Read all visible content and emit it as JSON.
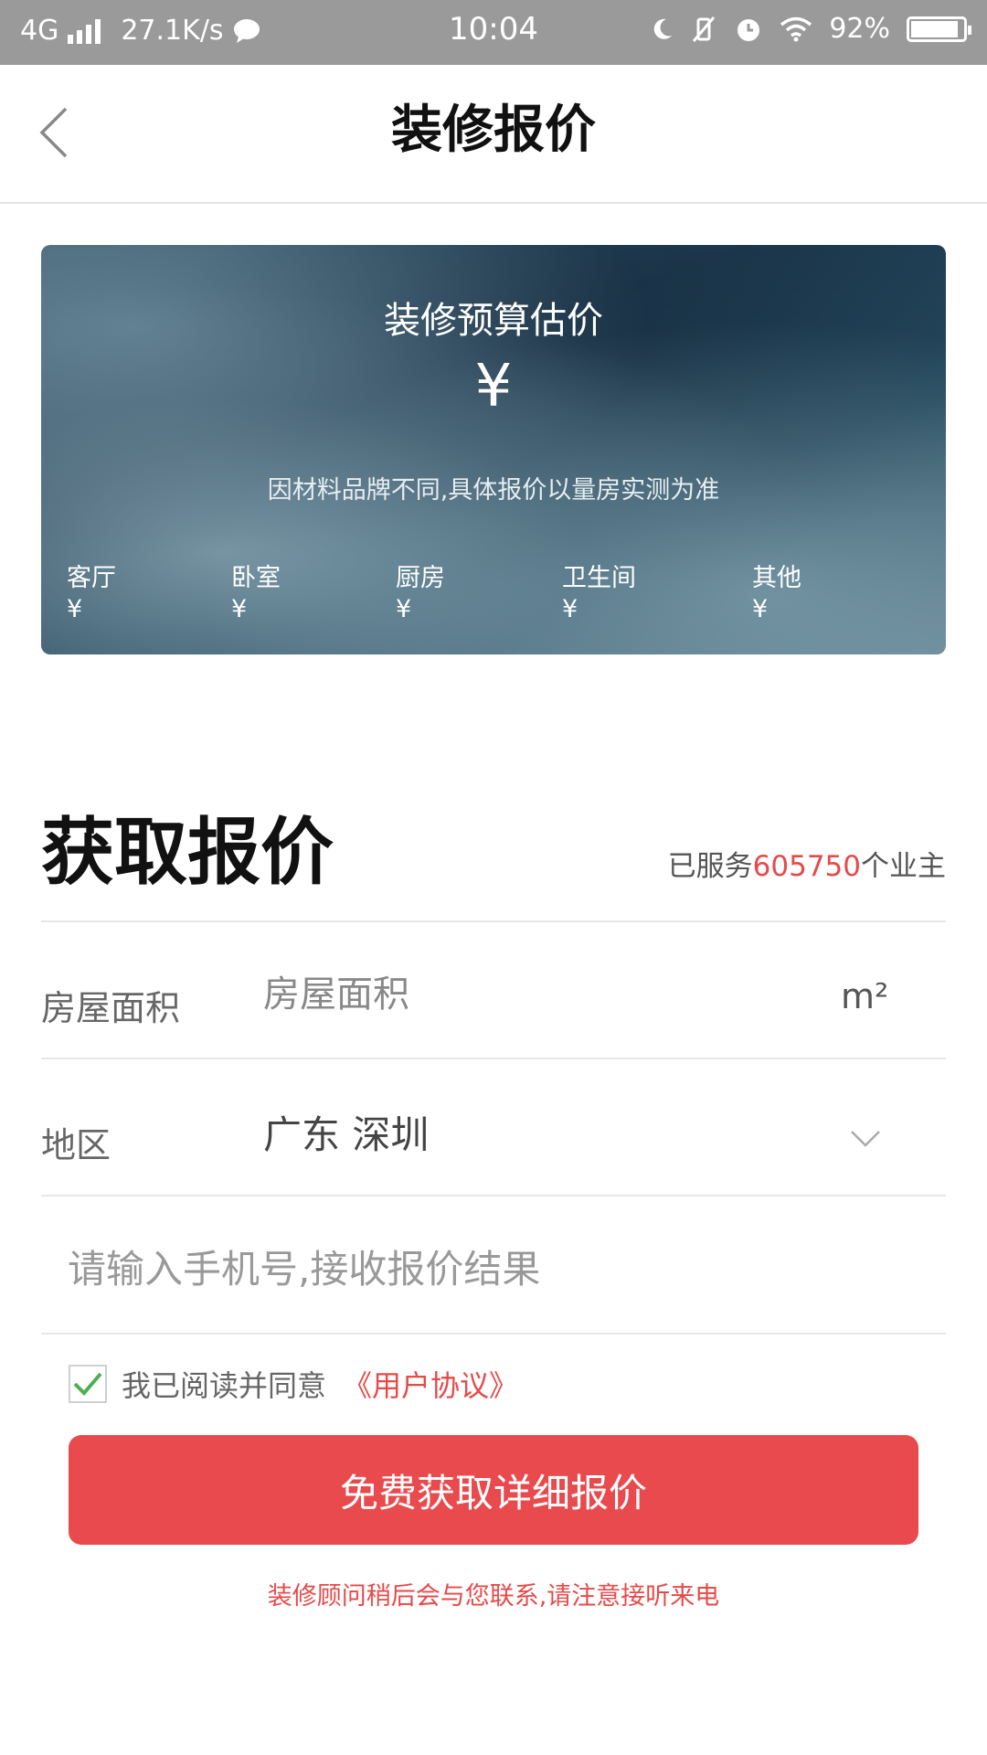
{
  "status_bar": {
    "network": "4G",
    "speed": "27.1K/s",
    "time": "10:04",
    "battery": "92%",
    "battery_level": 0.92,
    "icons": [
      "signal-icon",
      "chat-icon",
      "moon-icon",
      "mute-icon",
      "alarm-icon",
      "wifi-icon",
      "battery-icon"
    ]
  },
  "nav": {
    "title": "装修报价",
    "back_icon": "chevron-left-icon"
  },
  "banner": {
    "title": "装修预算估价",
    "yuan_symbol": "¥",
    "note": "因材料品牌不同,具体报价以量房实测为准",
    "rooms": [
      {
        "label": "客厅",
        "value": "¥"
      },
      {
        "label": "卧室",
        "value": "¥"
      },
      {
        "label": "厨房",
        "value": "¥"
      },
      {
        "label": "卫生间",
        "value": "¥"
      },
      {
        "label": "其他",
        "value": "¥"
      }
    ]
  },
  "quote": {
    "title": "获取报价",
    "served_prefix": "已服务",
    "served_count": "605750",
    "served_suffix": "个业主"
  },
  "form": {
    "area_label": "房屋面积",
    "area_placeholder": "房屋面积",
    "area_unit": "m²",
    "region_label": "地区",
    "region_value": "广东 深圳",
    "phone_placeholder": "请输入手机号,接收报价结果",
    "agree_text": "我已阅读并同意",
    "agreement_link": "《用户协议》",
    "agreed": true,
    "submit_label": "免费获取详细报价",
    "footnote": "装修顾问稍后会与您联系,请注意接听来电"
  },
  "colors": {
    "accent": "#e84a4d",
    "status_bar": "#9a9a9a",
    "check": "#4caf50"
  }
}
